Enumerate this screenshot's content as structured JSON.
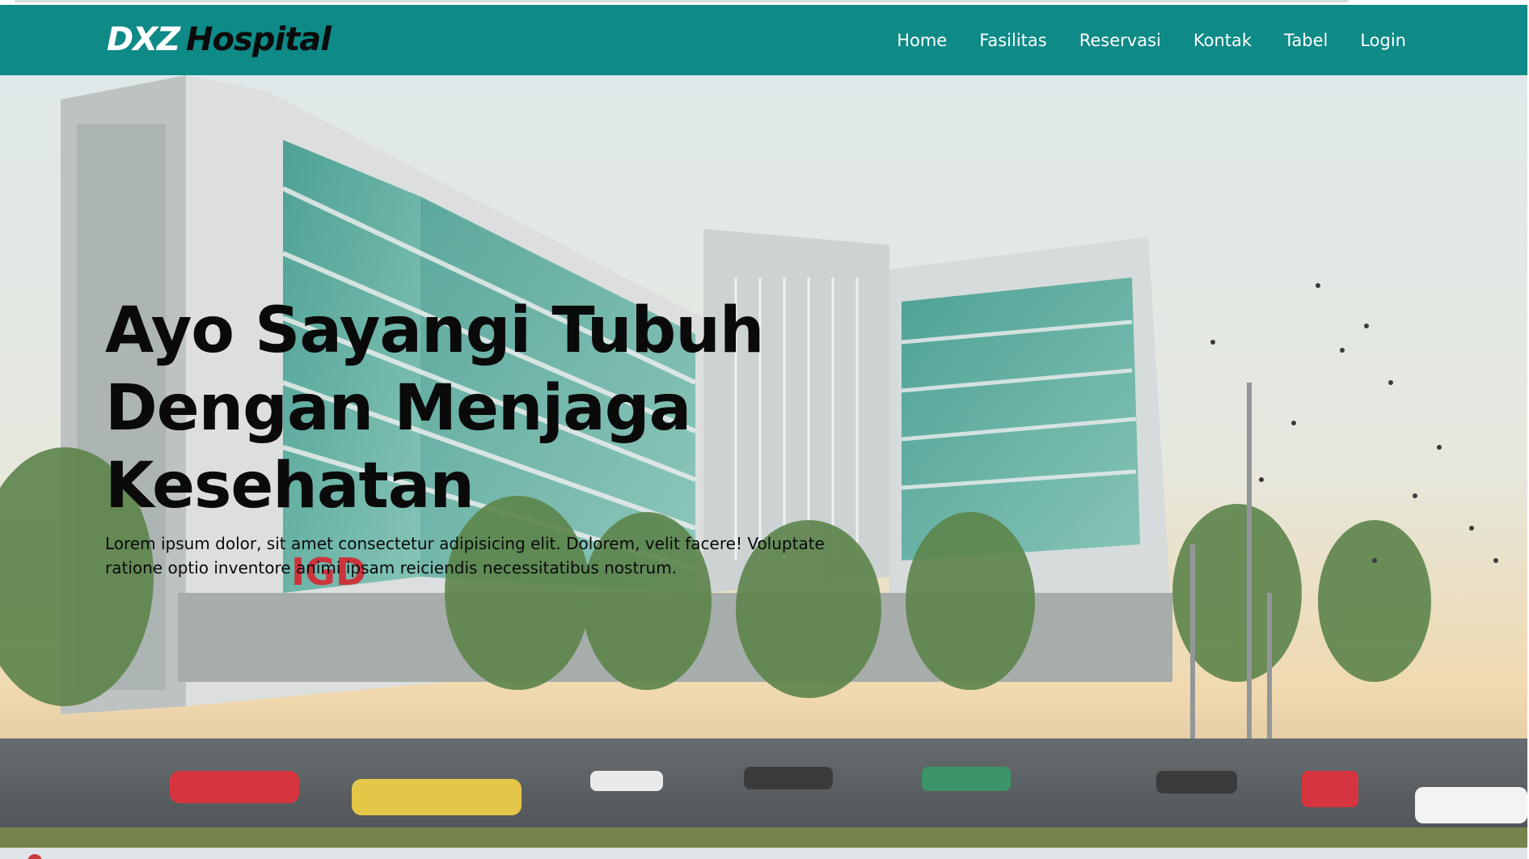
{
  "brand": {
    "part1": "DXZ",
    "part2": "Hospital"
  },
  "nav": {
    "items": [
      {
        "label": "Home"
      },
      {
        "label": "Fasilitas"
      },
      {
        "label": "Reservasi"
      },
      {
        "label": "Kontak"
      },
      {
        "label": "Tabel"
      },
      {
        "label": "Login"
      }
    ]
  },
  "hero": {
    "title_line1": "Ayo Sayangi Tubuh",
    "title_line2": "Dengan Menjaga",
    "title_line3": "Kesehatan",
    "description": "Lorem ipsum dolor, sit amet consectetur adipisicing elit. Dolorem, velit facere! Voluptate ratione optio inventore animi ipsam reiciendis necessitatibus nostrum.",
    "image_sign_text": "IGD",
    "image_sign_color": "#c8232c"
  },
  "colors": {
    "navbar": "#0e8a87",
    "brand_accent": "#ffffff",
    "brand_dark": "#0b0b0b",
    "text_dark": "#0a0a0a"
  }
}
